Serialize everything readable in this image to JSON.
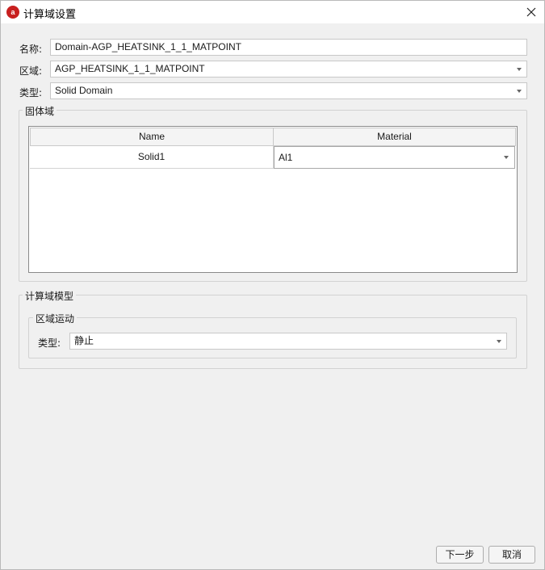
{
  "window": {
    "title": "计算域设置",
    "app_icon_glyph": "a",
    "accent_color": "#c8201f"
  },
  "form": {
    "name_label": "名称:",
    "name_value": "Domain-AGP_HEATSINK_1_1_MATPOINT",
    "region_label": "区域:",
    "region_value": "AGP_HEATSINK_1_1_MATPOINT",
    "type_label": "类型:",
    "type_value": "Solid Domain"
  },
  "solid_group": {
    "title": "固体域",
    "columns": [
      "Name",
      "Material"
    ],
    "rows": [
      {
        "name": "Solid1",
        "material": "Al1"
      }
    ]
  },
  "model_group": {
    "title": "计算域模型",
    "motion_group": {
      "title": "区域运动",
      "type_label": "类型:",
      "type_value": "静止"
    }
  },
  "footer": {
    "next_label": "下一步",
    "cancel_label": "取消"
  }
}
